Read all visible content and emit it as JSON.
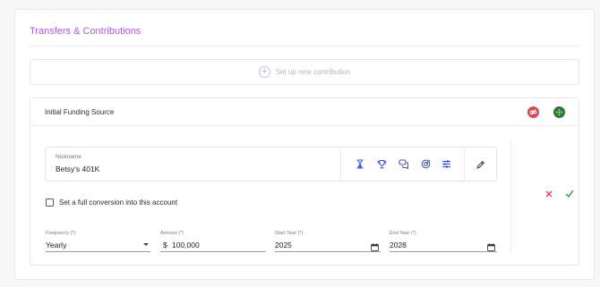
{
  "card": {
    "title": "Transfers & Contributions"
  },
  "setup": {
    "label": "Set up new contribution"
  },
  "source": {
    "title": "Initial Funding Source",
    "nickname_label": "Nickname",
    "nickname_value": "Betsy's 401K",
    "checkbox_label": "Set a full conversion into this account",
    "checkbox_checked": false
  },
  "fields": {
    "frequency": {
      "label": "Frequency (*)",
      "value": "Yearly"
    },
    "amount": {
      "label": "Amount (*)",
      "prefix": "$",
      "value": "100,000"
    },
    "start_year": {
      "label": "Start Year (*)",
      "value": "2025"
    },
    "end_year": {
      "label": "End Year (*)",
      "value": "2028"
    }
  },
  "icons": {
    "header_actions": [
      "unlink-icon",
      "move-icon"
    ],
    "toolbar": [
      "hourglass-icon",
      "trophy-icon",
      "chat-icon",
      "target-icon",
      "sliders-icon"
    ],
    "edit": "pencil-icon",
    "row_actions": [
      "close-icon",
      "check-icon"
    ]
  },
  "colors": {
    "accent": "#a85bd8",
    "icon_blue": "#3d5bd9",
    "danger": "#e2434d",
    "success": "#2f9a48",
    "dark_green": "#2d7a34"
  }
}
